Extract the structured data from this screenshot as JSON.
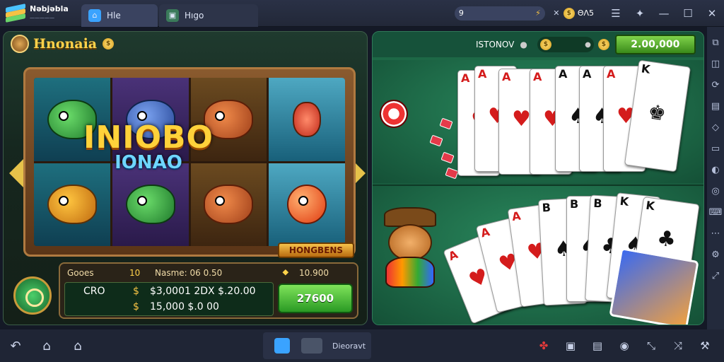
{
  "app": {
    "name": "Nəbjəbla",
    "subtitle": "—————"
  },
  "tabs": [
    {
      "label": "Hle",
      "icon": "home-icon"
    },
    {
      "label": "Hıgo",
      "icon": "game-icon"
    }
  ],
  "topbar": {
    "search_value": "9",
    "coin_value": "ΘΛ5",
    "colors": {
      "accent": "#3a4360"
    }
  },
  "slot": {
    "title": "Hnonaia",
    "game_title_line1": "INIOBO",
    "game_title_line2": "IONAO",
    "bonus_label": "HONGBENS",
    "info": {
      "left": "Gooes",
      "mid_icon": "10",
      "mid": "Nasme: 06 0.50",
      "right": "10.900"
    },
    "rows": [
      {
        "label": "CRO",
        "values": "$3,0001 2DX  $.20.00"
      },
      {
        "label": "",
        "values": "15,000 $.0  00"
      }
    ],
    "spin_label": "27600"
  },
  "cards": {
    "header_label": "ISTONOV",
    "balance": "2.00,000",
    "top_hand": [
      "A",
      "A",
      "A",
      "A",
      "A",
      "A",
      "A",
      "K"
    ],
    "bottom_hand": [
      "A",
      "A",
      "A",
      "B",
      "B",
      "B",
      "K",
      "K"
    ]
  },
  "navbar": {
    "center_label": "Dieoravt"
  }
}
